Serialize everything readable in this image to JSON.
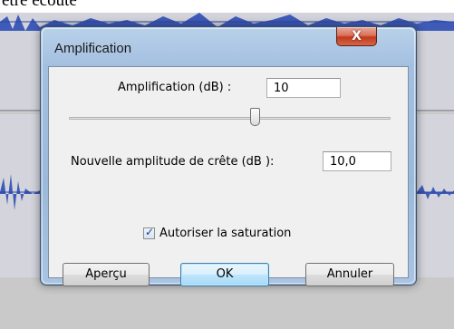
{
  "background": {
    "caption": "etre ecoute"
  },
  "dialog": {
    "title": "Amplification",
    "close_glyph": "X",
    "amplification_label": "Amplification (dB) :",
    "amplification_value": "10",
    "slider_position": 0.58,
    "peak_label": "Nouvelle amplitude de crête (dB ):",
    "peak_value": "10,0",
    "allow_clipping_label": "Autoriser la saturation",
    "allow_clipping_checked": true,
    "buttons": {
      "preview": "Aperçu",
      "ok": "OK",
      "cancel": "Annuler"
    }
  },
  "colors": {
    "frame": "#a4c0e0",
    "close_button": "#c23a1c",
    "client_bg": "#f0f0f0",
    "default_button": "#bee6fd"
  }
}
